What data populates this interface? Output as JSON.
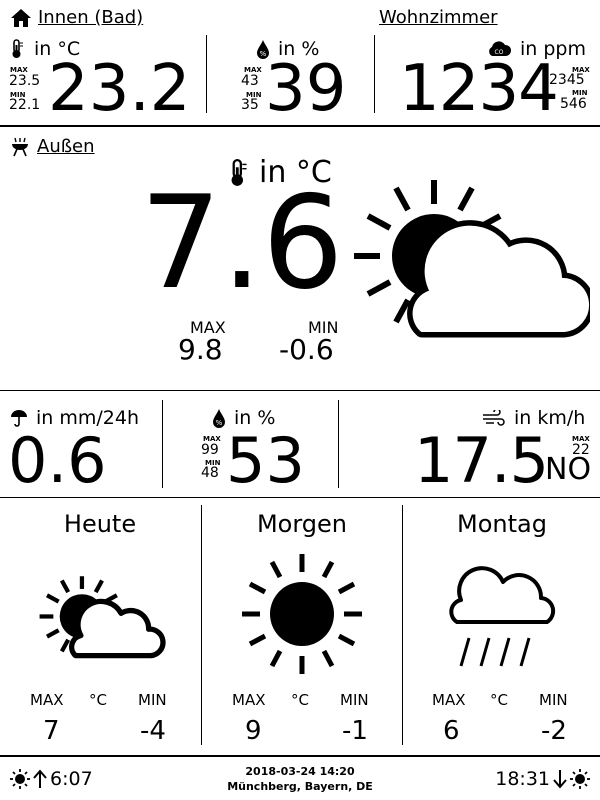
{
  "indoor": {
    "title": "Innen (Bad)",
    "temp": {
      "unit": "in °C",
      "max_label": "MAX",
      "max": "23.5",
      "min_label": "MIN",
      "min": "22.1",
      "value": "23.2"
    },
    "humidity": {
      "unit": "in %",
      "max_label": "MAX",
      "max": "43",
      "min_label": "MIN",
      "min": "35",
      "value": "39"
    }
  },
  "living": {
    "title": "Wohnzimmer",
    "co2": {
      "unit": "in ppm",
      "max_label": "MAX",
      "max": "2345",
      "min_label": "MIN",
      "min": "546",
      "value": "1234"
    }
  },
  "outdoor": {
    "title": "Außen",
    "temp_unit": "in °C",
    "temp": "7.6",
    "max_label": "MAX",
    "max": "9.8",
    "min_label": "MIN",
    "min": "-0.6",
    "condition_icon": "sun-behind-cloud-icon"
  },
  "metrics": {
    "rain": {
      "unit": "in mm/24h",
      "value": "0.6"
    },
    "humidity": {
      "unit": "in %",
      "max_label": "MAX",
      "max": "99",
      "min_label": "MIN",
      "min": "48",
      "value": "53"
    },
    "wind": {
      "unit": "in km/h",
      "max_label": "MAX",
      "max": "22",
      "value": "17.5",
      "direction": "NO"
    }
  },
  "forecast": [
    {
      "day": "Heute",
      "icon": "sun-behind-cloud-icon",
      "max_label": "MAX",
      "unit": "°C",
      "min_label": "MIN",
      "max": "7",
      "min": "-4"
    },
    {
      "day": "Morgen",
      "icon": "sun-icon",
      "max_label": "MAX",
      "unit": "°C",
      "min_label": "MIN",
      "max": "9",
      "min": "-1"
    },
    {
      "day": "Montag",
      "icon": "rain-cloud-icon",
      "max_label": "MAX",
      "unit": "°C",
      "min_label": "MIN",
      "max": "6",
      "min": "-2"
    }
  ],
  "footer": {
    "sunrise": "6:07",
    "sunset": "18:31",
    "datetime": "2018-03-24 14:20",
    "location": "Münchberg, Bayern, DE"
  }
}
